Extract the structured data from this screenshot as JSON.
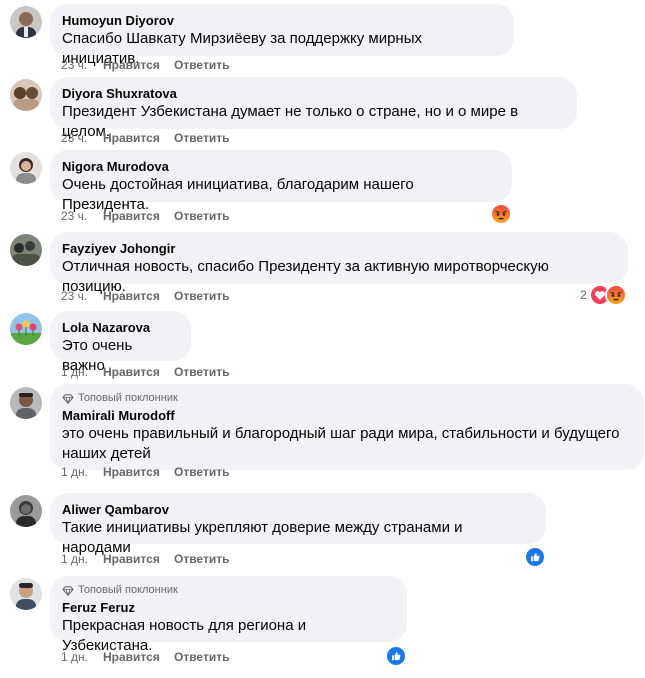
{
  "reactions_colors": {
    "angry": "#e9710f",
    "love": "#f33e58",
    "like": "#1877f2"
  },
  "comments": [
    {
      "author": "Humoyun Diyorov",
      "text": "Спасибо Шавкату Мирзиёеву за поддержку мирных инициатив.",
      "time": "23 ч.",
      "like": "Нравится",
      "reply": "Ответить"
    },
    {
      "author": "Diyora Shuxratova",
      "text": "Президент Узбекистана думает не только о стране, но и о мире в целом.",
      "time": "23 ч.",
      "like": "Нравится",
      "reply": "Ответить"
    },
    {
      "author": "Nigora Murodova",
      "text": "Очень достойная инициатива, благодарим нашего Президента.",
      "time": "23 ч.",
      "like": "Нравится",
      "reply": "Ответить",
      "reactions": [
        "angry-icon"
      ]
    },
    {
      "author": "Fayziyev Johongir",
      "text": "Отличная новость, спасибо Президенту за активную миротворческую позицию.",
      "time": "23 ч.",
      "like": "Нравится",
      "reply": "Ответить",
      "reaction_count": "2",
      "reactions": [
        "love-icon",
        "angry-icon"
      ]
    },
    {
      "author": "Lola Nazarova",
      "text": "Это очень важно",
      "time": "1 дн.",
      "like": "Нравится",
      "reply": "Ответить"
    },
    {
      "badge": "Топовый поклонник",
      "author": "Mamirali Murodoff",
      "text": "это очень правильный и благородный шаг ради мира, стабильности и будущего наших детей",
      "time": "1 дн.",
      "like": "Нравится",
      "reply": "Ответить"
    },
    {
      "author": "Aliwer Qambarov",
      "text": "Такие инициативы укрепляют доверие между странами и народами",
      "time": "1 дн.",
      "like": "Нравится",
      "reply": "Ответить",
      "reactions": [
        "like-icon"
      ]
    },
    {
      "badge": "Топовый поклонник",
      "author": "Feruz Feruz",
      "text": "Прекрасная новость для региона и Узбекистана.",
      "time": "1 дн.",
      "like": "Нравится",
      "reply": "Ответить",
      "reactions": [
        "like-icon"
      ]
    }
  ]
}
